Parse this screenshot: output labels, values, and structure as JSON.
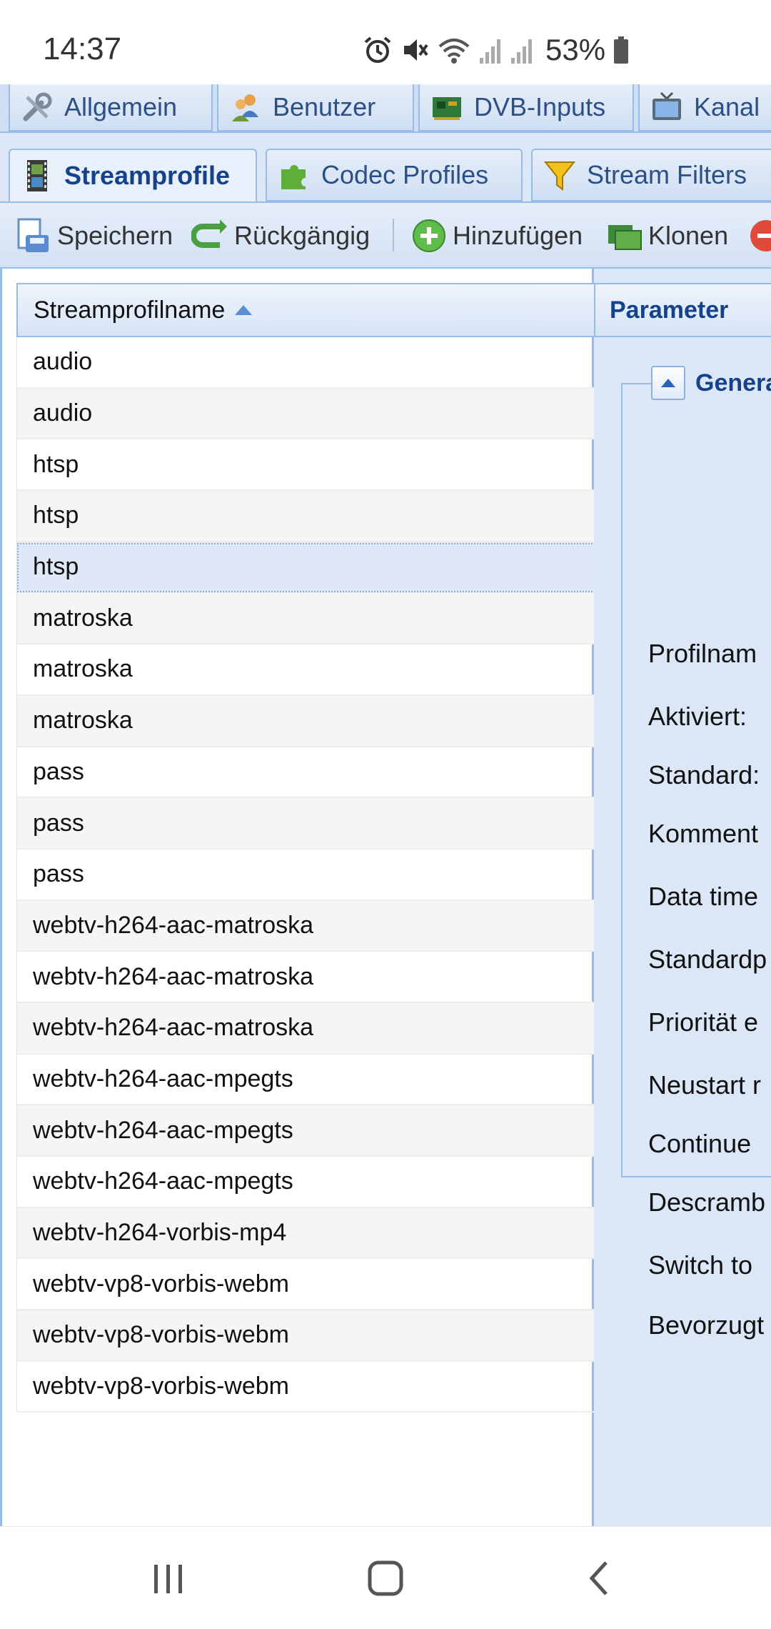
{
  "status_bar": {
    "time": "14:37",
    "battery": "53%"
  },
  "top_tabs": [
    {
      "label": "Allgemein",
      "icon": "wrench-icon"
    },
    {
      "label": "Benutzer",
      "icon": "users-icon"
    },
    {
      "label": "DVB-Inputs",
      "icon": "card-icon"
    },
    {
      "label": "Kanal",
      "icon": "tv-icon"
    }
  ],
  "sub_tabs": [
    {
      "label": "Streamprofile",
      "icon": "film-icon",
      "active": true
    },
    {
      "label": "Codec Profiles",
      "icon": "puzzle-icon"
    },
    {
      "label": "Stream Filters",
      "icon": "filter-icon"
    }
  ],
  "toolbar": {
    "save": "Speichern",
    "undo": "Rückgängig",
    "add": "Hinzufügen",
    "clone": "Klonen"
  },
  "grid": {
    "column_header": "Streamprofilname",
    "rows": [
      "audio",
      "audio",
      "htsp",
      "htsp",
      "htsp",
      "matroska",
      "matroska",
      "matroska",
      "pass",
      "pass",
      "pass",
      "webtv-h264-aac-matroska",
      "webtv-h264-aac-matroska",
      "webtv-h264-aac-matroska",
      "webtv-h264-aac-mpegts",
      "webtv-h264-aac-mpegts",
      "webtv-h264-aac-mpegts",
      "webtv-h264-vorbis-mp4",
      "webtv-vp8-vorbis-webm",
      "webtv-vp8-vorbis-webm",
      "webtv-vp8-vorbis-webm"
    ],
    "selected_index": 4
  },
  "panel": {
    "header": "Parameter",
    "section": "Genera",
    "labels": [
      "Profilnam",
      "Aktiviert:",
      "Standard:",
      "Komment",
      "Data time",
      "Standardp",
      "Priorität e",
      "Neustart r",
      "Continue",
      "Descramb",
      "Switch to",
      "Bevorzugt"
    ]
  },
  "colors": {
    "accent": "#15428b",
    "panel_bg": "#dbe7f7",
    "border": "#99bbe8"
  }
}
